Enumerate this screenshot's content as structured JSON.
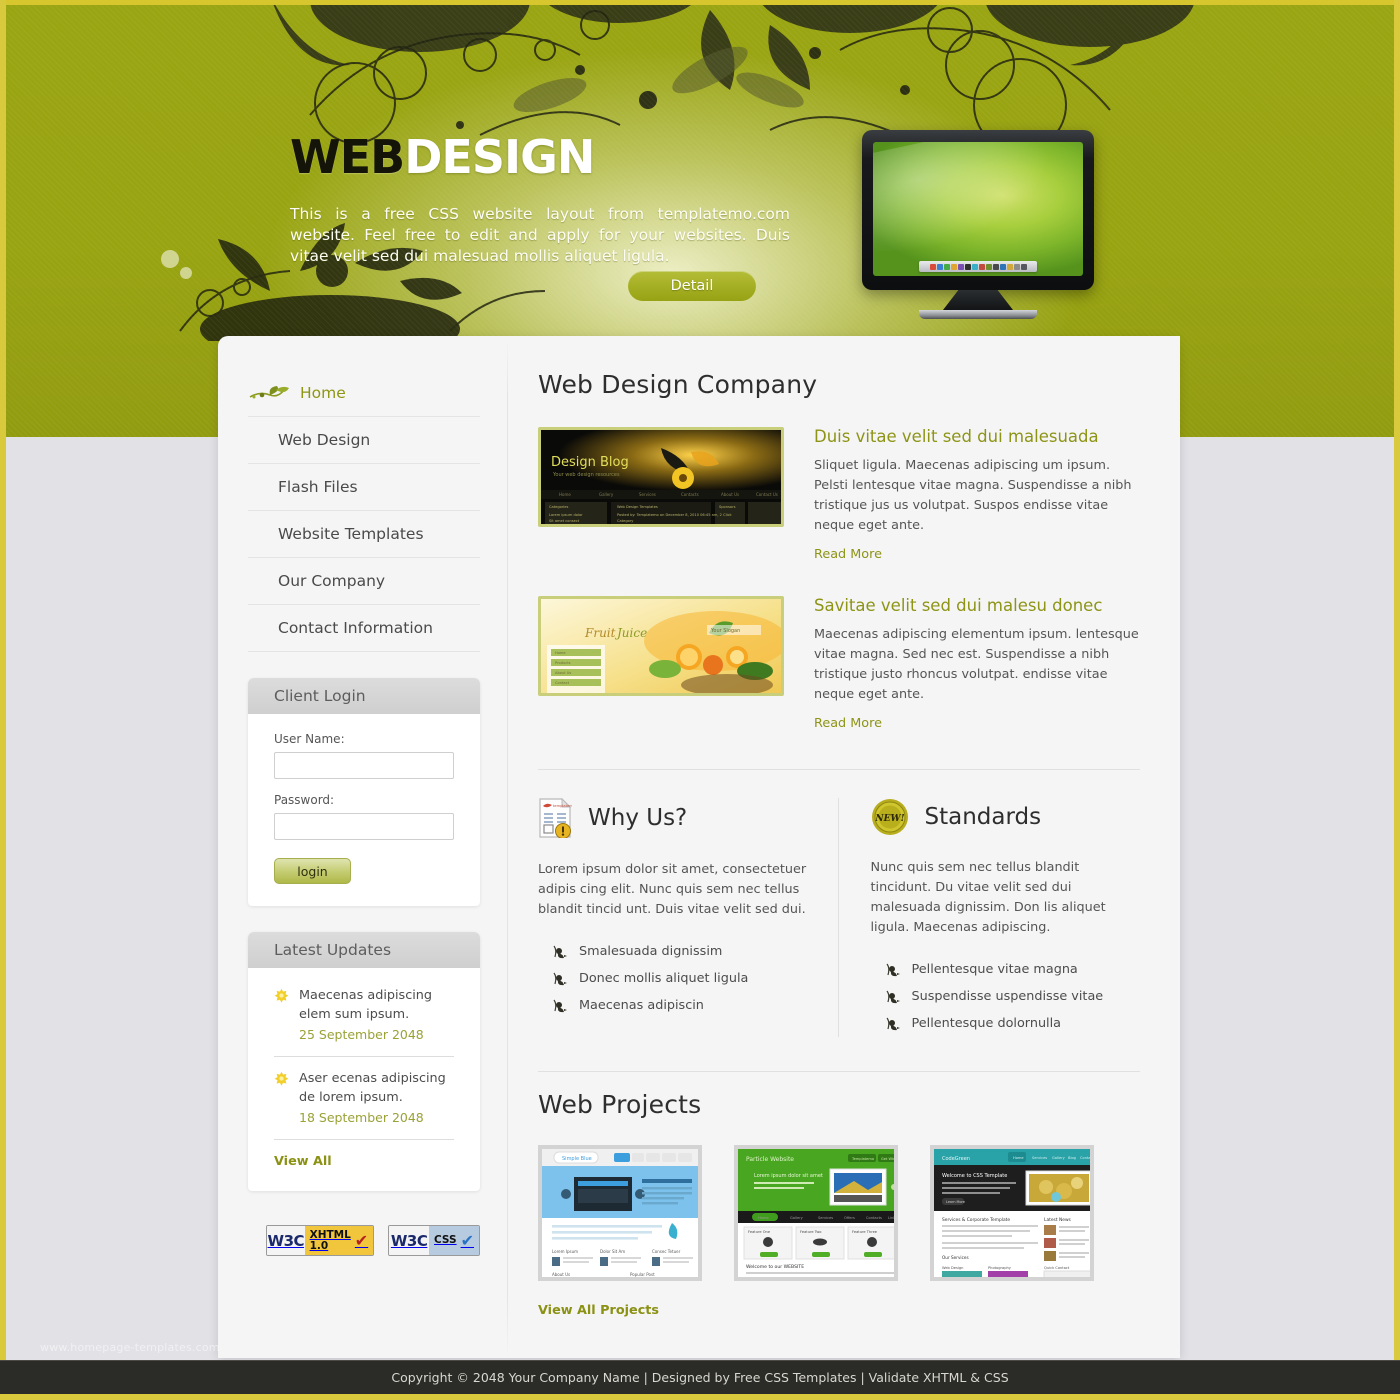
{
  "hero": {
    "title_part1": "WEB",
    "title_part2": "DESIGN",
    "description": "This is a free CSS website layout from templatemo.com website. Feel free to edit and apply for your websites. Duis vitae velit sed dui malesuad mollis aliquet ligula.",
    "detail_button": "Detail",
    "monitor_icon": "lcd-monitor-icon"
  },
  "sidebar": {
    "nav": [
      {
        "label": "Home",
        "active": true,
        "icon": "leaf-swirl-icon"
      },
      {
        "label": "Web Design",
        "active": false
      },
      {
        "label": "Flash Files",
        "active": false
      },
      {
        "label": "Website Templates",
        "active": false
      },
      {
        "label": "Our Company",
        "active": false
      },
      {
        "label": "Contact Information",
        "active": false
      }
    ],
    "login": {
      "heading": "Client Login",
      "username_label": "User Name:",
      "username_value": "",
      "username_placeholder": "",
      "password_label": "Password:",
      "password_value": "",
      "password_placeholder": "",
      "submit_label": "login"
    },
    "updates": {
      "heading": "Latest Updates",
      "items": [
        {
          "icon": "star-icon",
          "text": "Maecenas adipiscing elem sum ipsum.",
          "date": "25 September 2048"
        },
        {
          "icon": "star-icon",
          "text": "Aser ecenas adipiscing de lorem ipsum.",
          "date": "18 September 2048"
        }
      ],
      "view_all": "View All"
    },
    "badges": [
      {
        "org": "W3C",
        "label_line1": "XHTML",
        "label_line2": "1.0",
        "check": "red-check-icon"
      },
      {
        "org": "W3C",
        "label_line1": "CSS",
        "label_line2": "",
        "check": "blue-check-icon"
      }
    ]
  },
  "main": {
    "heading": "Web Design Company",
    "articles": [
      {
        "thumb_name": "design-blog-screenshot",
        "thumb_caption": "Design Blog",
        "thumb_subcaption": "Your web design resources",
        "title": "Duis vitae velit sed dui malesuada",
        "text": "Sliquet ligula. Maecenas adipiscing um ipsum. Pelsti lentesque vitae magna. Suspendisse a nibh tristique jus us volutpat. Suspos endisse vitae neque eget ante.",
        "read_more": "Read More"
      },
      {
        "thumb_name": "fruit-juice-screenshot",
        "thumb_caption": "Fruit Juice",
        "thumb_subcaption": "Your Slogan",
        "title": "Savitae velit sed dui malesu donec",
        "text": "Maecenas adipiscing elementum ipsum. lentesque vitae magna. Sed nec est. Suspendisse a nibh tristique justo rhoncus volutpat. endisse vitae neque eget ante.",
        "read_more": "Read More"
      }
    ],
    "columns": [
      {
        "icon": "document-alert-icon",
        "title": "Why Us?",
        "text": "Lorem ipsum dolor sit amet, consectetuer adipis cing elit. Nunc quis sem nec tellus blandit tincid unt. Duis vitae velit sed dui.",
        "bullets": [
          "Smalesuada dignissim",
          "Donec mollis aliquet ligula",
          "Maecenas adipiscin"
        ]
      },
      {
        "icon": "new-badge-icon",
        "title": "Standards",
        "text": "Nunc quis sem nec tellus blandit tincidunt. Du vitae velit sed dui malesuada dignissim. Don lis aliquet ligula. Maecenas adipiscing.",
        "bullets": [
          "Pellentesque vitae magna",
          "Suspendisse uspendisse vitae",
          "Pellentesque dolornulla"
        ]
      }
    ],
    "projects": {
      "heading": "Web Projects",
      "items": [
        {
          "name": "project-thumbnail-blue",
          "theme": "#3d9ede"
        },
        {
          "name": "project-thumbnail-green",
          "theme": "#4fa81e"
        },
        {
          "name": "project-thumbnail-teal",
          "theme": "#2aa3a8"
        }
      ],
      "view_all": "View All Projects"
    }
  },
  "footer": {
    "text": "Copyright © 2048 Your Company Name | Designed by Free CSS Templates | Validate XHTML & CSS",
    "watermark": "www.homepage-templates.com"
  },
  "colors": {
    "banner_green": "#99a412",
    "accent_olive": "#8d9416",
    "yellow_edge": "#d9c93c",
    "footer_dark": "#2b2b27",
    "body_gray": "#e1e1e6"
  }
}
